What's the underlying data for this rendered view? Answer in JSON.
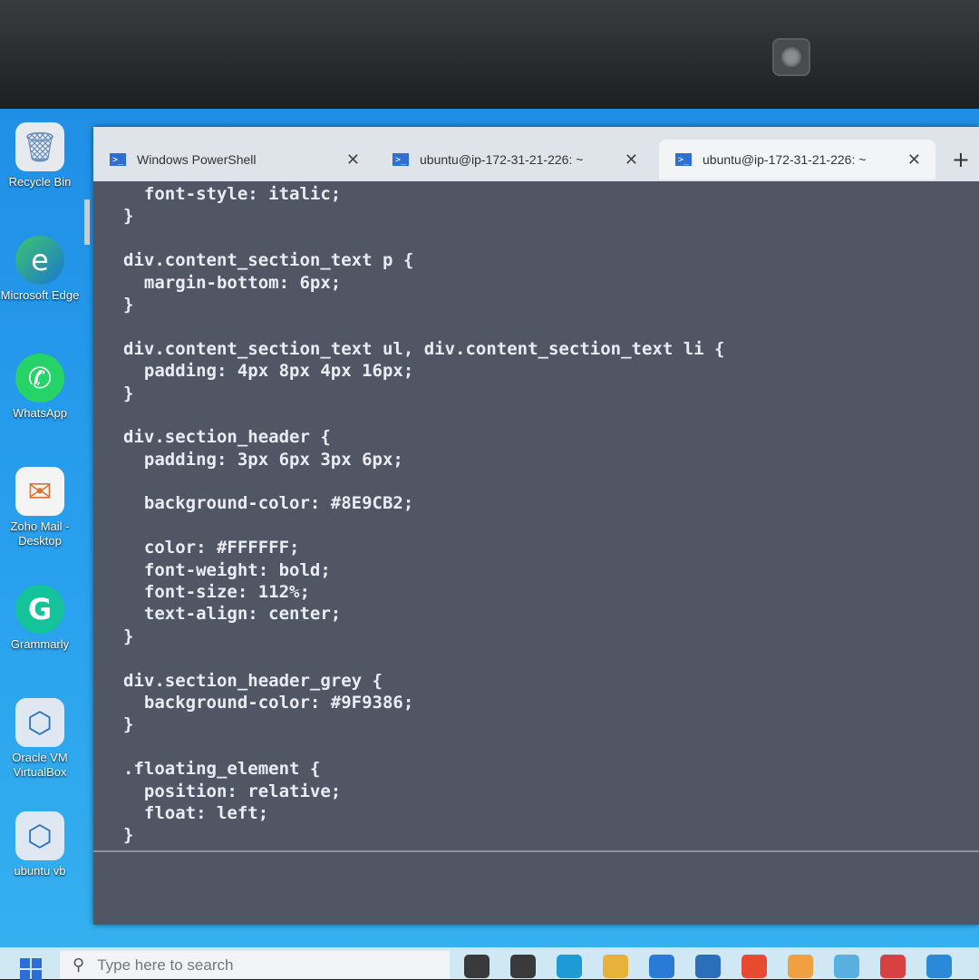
{
  "desktop": {
    "icons": [
      {
        "label": "Recycle Bin",
        "icon": "recycle-bin-icon",
        "glyph": "🗑"
      },
      {
        "label": "Microsoft Edge",
        "icon": "edge-icon",
        "glyph": "e"
      },
      {
        "label": "WhatsApp",
        "icon": "whatsapp-icon",
        "glyph": "✆"
      },
      {
        "label": "Zoho Mail - Desktop",
        "icon": "zoho-mail-icon",
        "glyph": "✉"
      },
      {
        "label": "Grammarly",
        "icon": "grammarly-icon",
        "glyph": "G"
      },
      {
        "label": "Oracle VM VirtualBox",
        "icon": "virtualbox-icon",
        "glyph": "⬡"
      },
      {
        "label": "ubuntu vb",
        "icon": "virtualbox-vm-icon",
        "glyph": "⬡"
      }
    ]
  },
  "terminal": {
    "tabs": [
      {
        "title": "Windows PowerShell",
        "icon": "powershell-icon",
        "close": "✕"
      },
      {
        "title": "ubuntu@ip-172-31-21-226: ~",
        "icon": "powershell-icon",
        "close": "✕"
      },
      {
        "title": "ubuntu@ip-172-31-21-226: ~",
        "icon": "powershell-icon",
        "close": "✕",
        "active": true
      }
    ],
    "new_tab": "+",
    "lines": [
      "  font-style: italic;",
      "}",
      "",
      "div.content_section_text p {",
      "  margin-bottom: 6px;",
      "}",
      "",
      "div.content_section_text ul, div.content_section_text li {",
      "  padding: 4px 8px 4px 16px;",
      "}",
      "",
      "div.section_header {",
      "  padding: 3px 6px 3px 6px;",
      "",
      "  background-color: #8E9CB2;",
      "",
      "  color: #FFFFFF;",
      "  font-weight: bold;",
      "  font-size: 112%;",
      "  text-align: center;",
      "}",
      "",
      "div.section_header_grey {",
      "  background-color: #9F9386;",
      "}",
      "",
      ".floating_element {",
      "  position: relative;",
      "  float: left;",
      "}"
    ]
  },
  "taskbar": {
    "search_placeholder": "Type here to search",
    "pinned": [
      {
        "icon": "cortana-icon",
        "color": "#3a3a3a"
      },
      {
        "icon": "task-view-icon",
        "color": "#3a3a3a"
      },
      {
        "icon": "edge-taskbar-icon",
        "color": "#1e9ad6"
      },
      {
        "icon": "file-explorer-icon",
        "color": "#e8b23a"
      },
      {
        "icon": "mail-icon",
        "color": "#2a7bd8"
      },
      {
        "icon": "virtualbox-taskbar-icon",
        "color": "#2a6fb8"
      },
      {
        "icon": "store-icon",
        "color": "#e84a2f"
      },
      {
        "icon": "tools-icon",
        "color": "#f0a040"
      },
      {
        "icon": "folder-icon",
        "color": "#58b0e0"
      },
      {
        "icon": "chrome-icon",
        "color": "#d94040"
      },
      {
        "icon": "vscode-icon",
        "color": "#2a8ad8"
      }
    ]
  },
  "colors": {
    "desktop": "#2aa2ee",
    "terminal_bg": "#505663",
    "tab_bar": "#dfe3ea"
  }
}
